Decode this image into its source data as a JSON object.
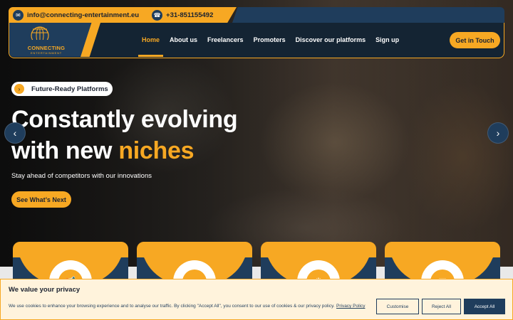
{
  "topbar": {
    "email": "info@connecting-entertainment.eu",
    "email_icon": "mail-icon",
    "phone": "+31-851155492",
    "phone_icon": "phone-icon"
  },
  "logo": {
    "name": "CONNECTING",
    "sub": "ENTERTAINMENT"
  },
  "nav": {
    "items": [
      {
        "label": "Home",
        "active": true
      },
      {
        "label": "About us"
      },
      {
        "label": "Freelancers"
      },
      {
        "label": "Promoters"
      },
      {
        "label": "Discover our platforms"
      },
      {
        "label": "Sign up"
      }
    ],
    "cta": "Get in Touch"
  },
  "hero": {
    "pill": "Future-Ready Platforms",
    "headline_line1": "Constantly evolving",
    "headline_line2_prefix": "with new ",
    "headline_accent": "niches",
    "subline": "Stay ahead of competitors with our innovations",
    "button": "See What’s Next"
  },
  "slider": {
    "prev_icon": "chevron-left-icon",
    "next_icon": "chevron-right-icon"
  },
  "cards": [
    {
      "icon": "megaphone-icon"
    },
    {
      "icon": "monitor-icon"
    },
    {
      "icon": "gear-icon"
    },
    {
      "icon": "document-icon"
    }
  ],
  "cookie": {
    "title": "We value your privacy",
    "text": "We use cookies to enhance your browsing experience and to analyse our traffic. By clicking \"Accept All\", you consent to our use of cookies & our privacy policy.",
    "link": "Privacy Policy",
    "customise": "Customise",
    "reject": "Reject All",
    "accept": "Accept All"
  },
  "colors": {
    "accent": "#f7a823",
    "navy": "#1f3d5c",
    "dark": "#142433"
  }
}
